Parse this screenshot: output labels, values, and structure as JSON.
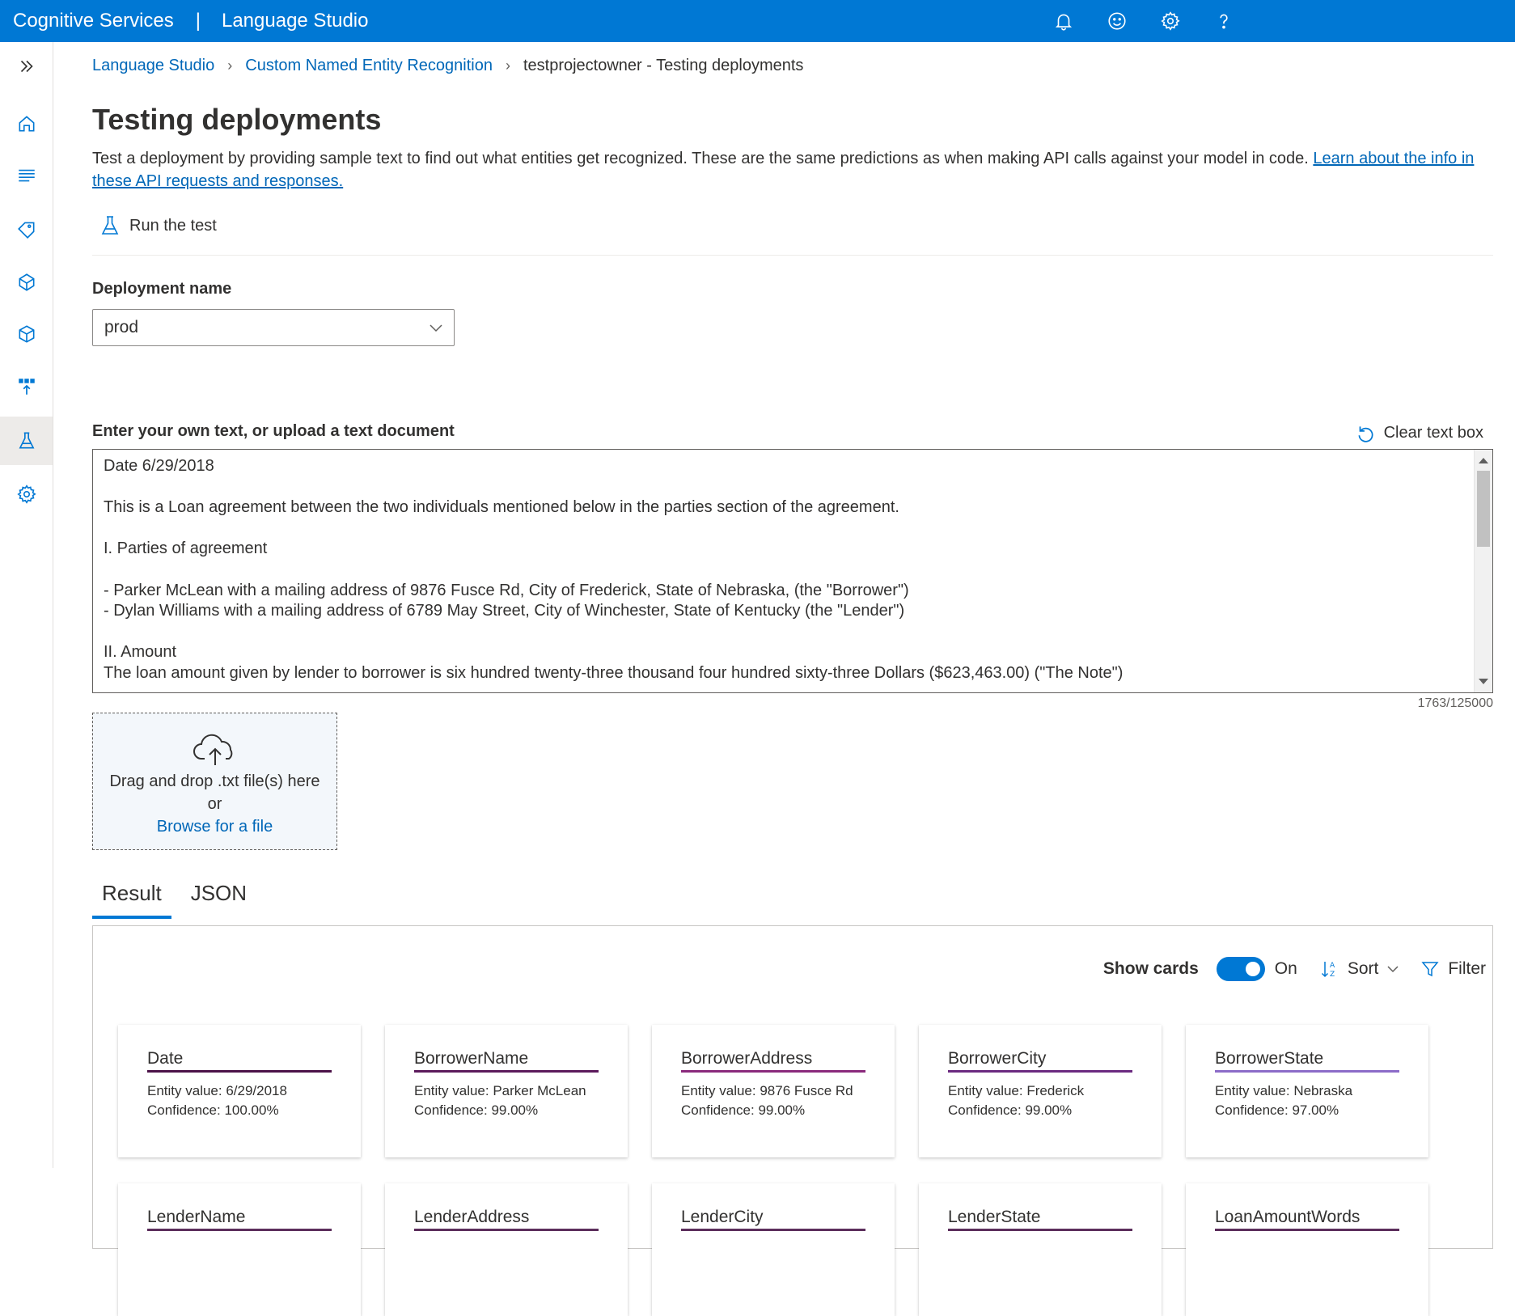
{
  "header": {
    "product": "Cognitive Services",
    "separator": "|",
    "app": "Language Studio",
    "icons": [
      "bell-icon",
      "smiley-icon",
      "gear-icon",
      "help-icon"
    ]
  },
  "breadcrumb": {
    "items": [
      "Language Studio",
      "Custom Named Entity Recognition"
    ],
    "current": "testprojectowner - Testing deployments"
  },
  "page": {
    "title": "Testing deployments",
    "description": "Test a deployment by providing sample text to find out what entities get recognized. These are the same predictions as when making API calls against your model in code. ",
    "learn_link": "Learn about the info in these API requests and responses.",
    "run_test": "Run the test"
  },
  "deployment": {
    "label": "Deployment name",
    "value": "prod"
  },
  "text_input": {
    "label": "Enter your own text, or upload a text document",
    "clear_label": "Clear text box",
    "lines": [
      "Date 6/29/2018",
      "",
      "This is a Loan agreement between the two individuals mentioned below in the parties section of the agreement.",
      "",
      "I. Parties of agreement",
      "",
      "- Parker McLean with a mailing address of 9876 Fusce Rd, City of Frederick, State of Nebraska, (the \"Borrower\")",
      "- Dylan Williams with a mailing address of 6789 May Street, City of Winchester, State of Kentucky (the \"Lender\")",
      "",
      "II. Amount",
      "The loan amount given by lender to borrower is six hundred twenty-three thousand four hundred sixty-three Dollars ($623,463.00) (\"The Note\")"
    ],
    "char_count": "1763/125000"
  },
  "dropzone": {
    "line1": "Drag and drop .txt file(s) here",
    "line2": "or",
    "browse": "Browse for a file"
  },
  "tabs": [
    {
      "label": "Result",
      "active": true
    },
    {
      "label": "JSON",
      "active": false
    }
  ],
  "toolbar": {
    "show_cards": "Show cards",
    "toggle_state": "On",
    "sort": "Sort",
    "filter": "Filter"
  },
  "cards": [
    {
      "name": "Date",
      "value": "Entity value: 6/29/2018",
      "confidence": "Confidence: 100.00%",
      "color": "#4b1248"
    },
    {
      "name": "BorrowerName",
      "value": "Entity value: Parker McLean",
      "confidence": "Confidence: 99.00%",
      "color": "#5c1a5c"
    },
    {
      "name": "BorrowerAddress",
      "value": "Entity value: 9876 Fusce Rd",
      "confidence": "Confidence: 99.00%",
      "color": "#8a2a7c"
    },
    {
      "name": "BorrowerCity",
      "value": "Entity value: Frederick",
      "confidence": "Confidence: 99.00%",
      "color": "#6b2a80"
    },
    {
      "name": "BorrowerState",
      "value": "Entity value: Nebraska",
      "confidence": "Confidence: 97.00%",
      "color": "#8c6cc8"
    }
  ],
  "cards_row2": [
    "LenderName",
    "LenderAddress",
    "LenderCity",
    "LenderState",
    "LoanAmountWords"
  ]
}
